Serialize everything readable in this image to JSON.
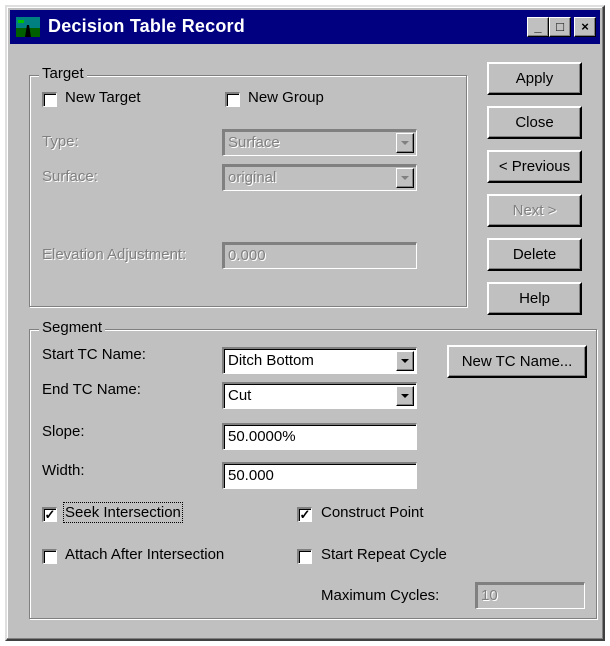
{
  "window": {
    "title": "Decision Table Record",
    "icon": "app-road-icon",
    "controls": {
      "minimize": "_",
      "maximize": "□",
      "close": "×"
    }
  },
  "buttons": {
    "apply": "Apply",
    "close": "Close",
    "previous": "< Previous",
    "next": "Next >",
    "delete": "Delete",
    "help": "Help",
    "new_tc_name": "New TC Name..."
  },
  "target": {
    "group_label": "Target",
    "new_target": {
      "label": "New Target",
      "checked": false
    },
    "new_group": {
      "label": "New Group",
      "checked": false
    },
    "type": {
      "label": "Type:",
      "value": "Surface"
    },
    "surface": {
      "label": "Surface:",
      "value": "original"
    },
    "elevation_adjustment": {
      "label": "Elevation Adjustment:",
      "value": "0.000"
    }
  },
  "segment": {
    "group_label": "Segment",
    "start_tc_name": {
      "label": "Start TC Name:",
      "value": "Ditch Bottom"
    },
    "end_tc_name": {
      "label": "End TC Name:",
      "value": "Cut"
    },
    "slope": {
      "label": "Slope:",
      "value": "50.0000%"
    },
    "width": {
      "label": "Width:",
      "value": "50.000"
    },
    "seek_intersection": {
      "label": "Seek Intersection",
      "checked": true
    },
    "construct_point": {
      "label": "Construct Point",
      "checked": true
    },
    "attach_after_intersection": {
      "label": "Attach After Intersection",
      "checked": false
    },
    "start_repeat_cycle": {
      "label": "Start Repeat Cycle",
      "checked": false
    },
    "maximum_cycles": {
      "label": "Maximum Cycles:",
      "value": "10"
    }
  },
  "colors": {
    "titlebar": "#000080",
    "face": "#c0c0c0",
    "disabled_text": "#808080"
  }
}
